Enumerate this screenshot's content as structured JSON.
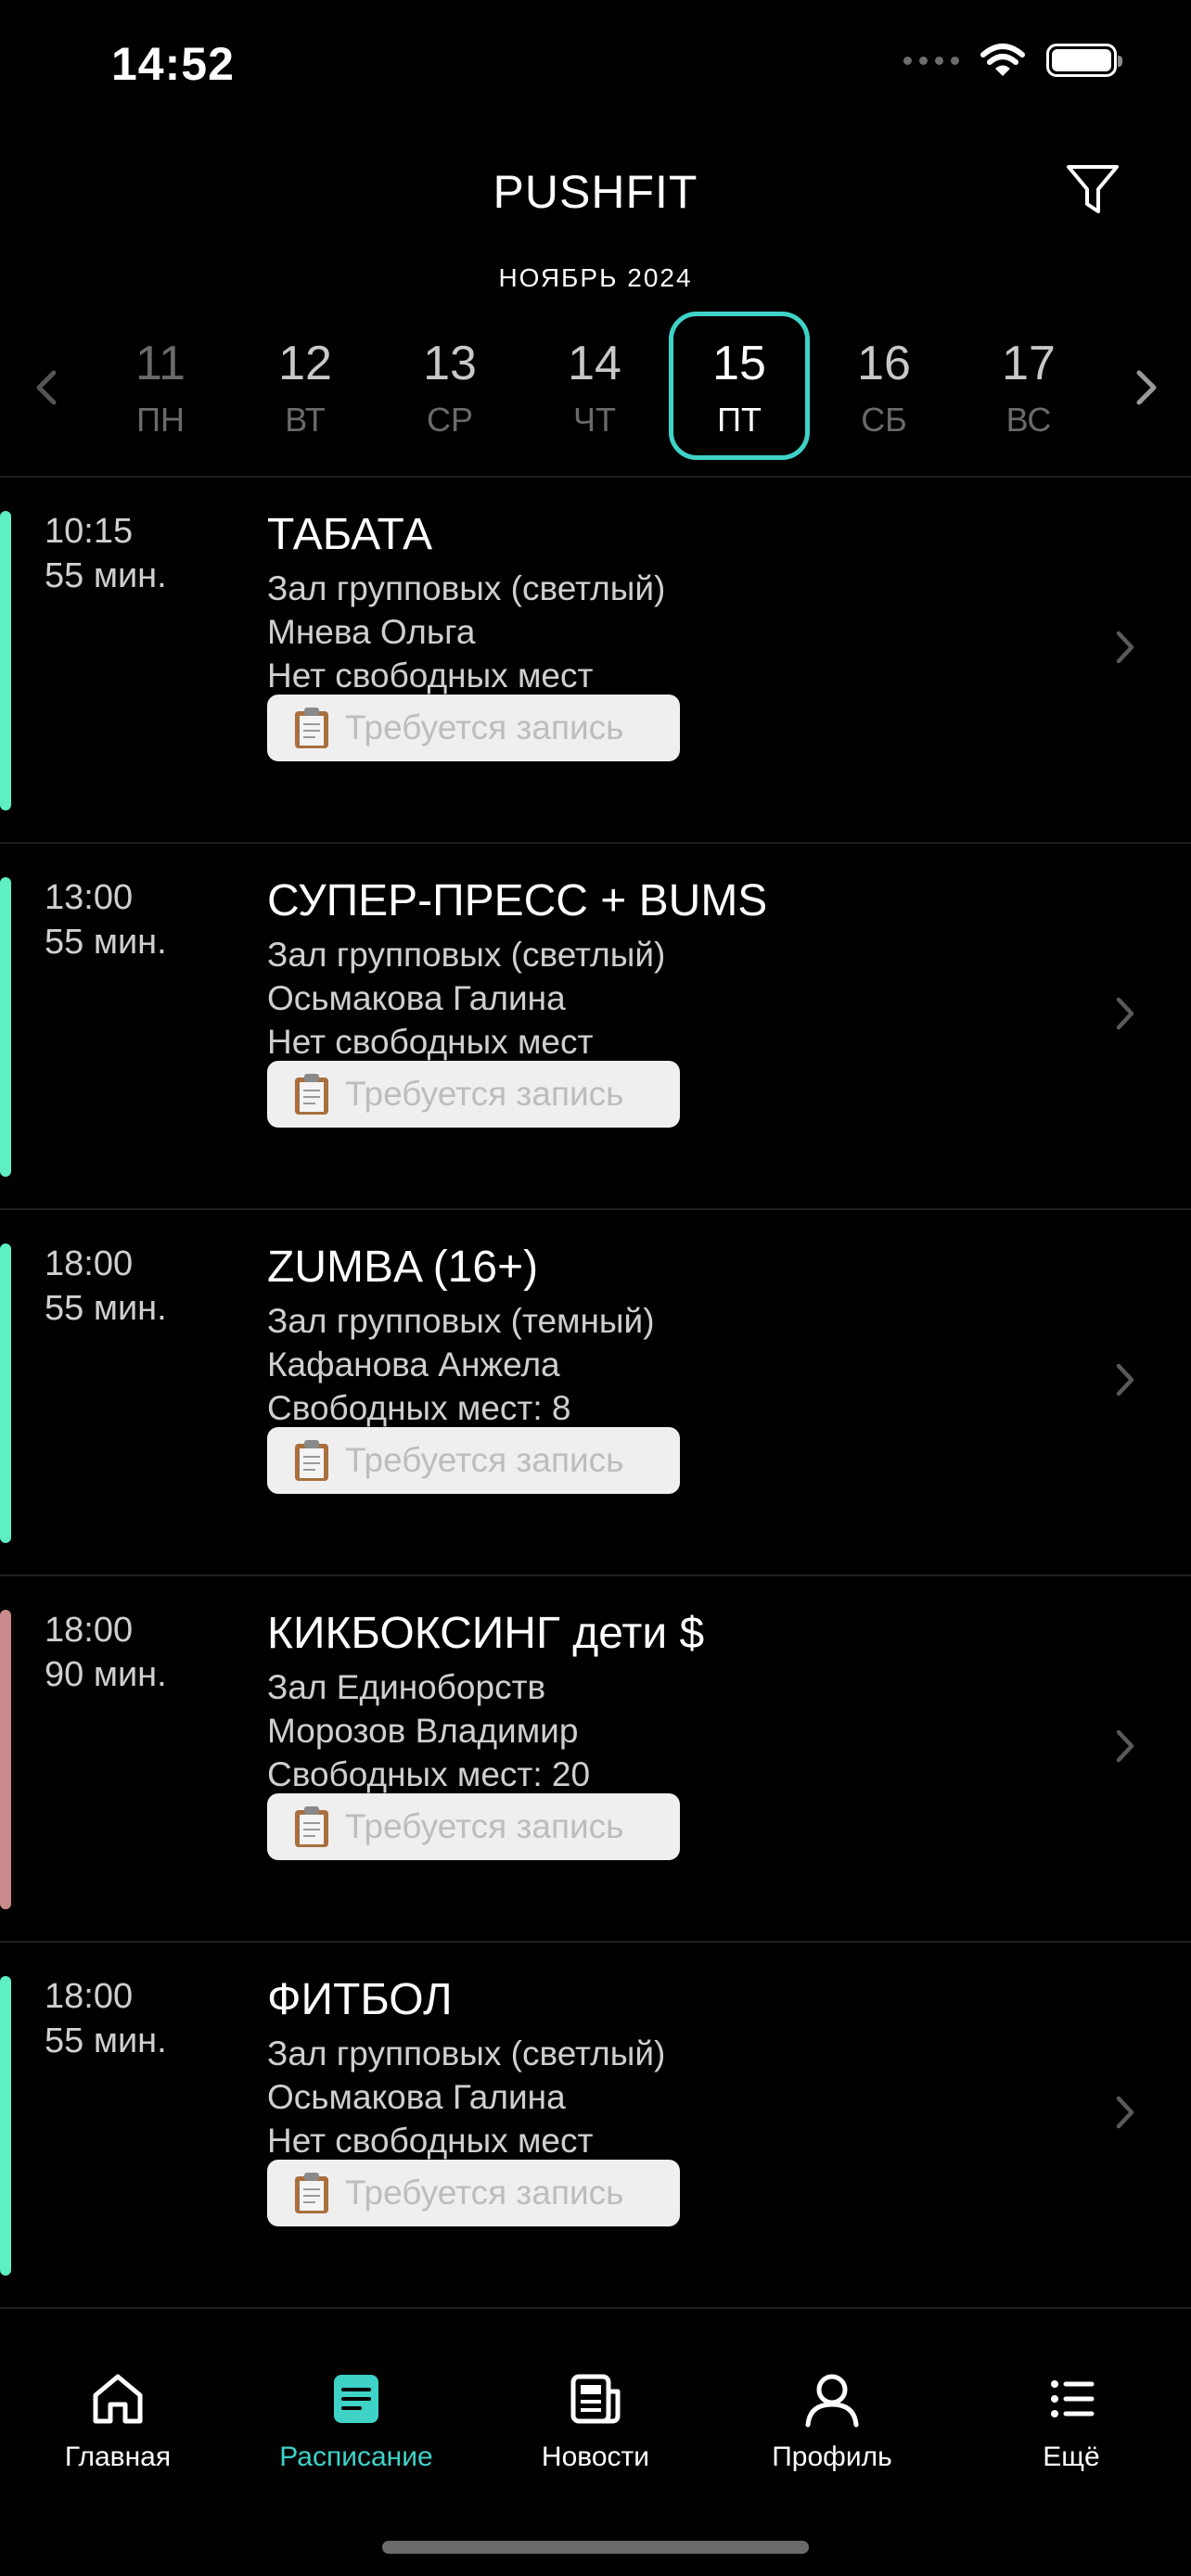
{
  "status_bar": {
    "time": "14:52"
  },
  "header": {
    "title": "PUSHFIT"
  },
  "calendar": {
    "month": "НОЯБРЬ 2024",
    "days": [
      {
        "num": "11",
        "weekday": "ПН"
      },
      {
        "num": "12",
        "weekday": "ВТ"
      },
      {
        "num": "13",
        "weekday": "СР"
      },
      {
        "num": "14",
        "weekday": "ЧТ"
      },
      {
        "num": "15",
        "weekday": "ПТ"
      },
      {
        "num": "16",
        "weekday": "СБ"
      },
      {
        "num": "17",
        "weekday": "ВС"
      }
    ],
    "selected_day": "15"
  },
  "classes": [
    {
      "time": "10:15",
      "duration": "55 мин.",
      "title": "ТАБАТА",
      "room": "Зал групповых (светлый)",
      "trainer": "Мнева Ольга",
      "availability": "Нет свободных мест",
      "badge": "Требуется запись",
      "accent_color": "#5ef0c4"
    },
    {
      "time": "13:00",
      "duration": "55 мин.",
      "title": "СУПЕР-ПРЕСС + BUMS",
      "room": "Зал групповых (светлый)",
      "trainer": "Осьмакова Галина",
      "availability": "Нет свободных мест",
      "badge": "Требуется запись",
      "accent_color": "#5ef0c4"
    },
    {
      "time": "18:00",
      "duration": "55 мин.",
      "title": "ZUMBA (16+)",
      "room": "Зал групповых (темный)",
      "trainer": "Кафанова Анжела",
      "availability": "Свободных мест: 8",
      "badge": "Требуется запись",
      "accent_color": "#5ef0c4"
    },
    {
      "time": "18:00",
      "duration": "90 мин.",
      "title": "КИКБОКСИНГ дети $",
      "room": "Зал Единоборств",
      "trainer": "Морозов Владимир",
      "availability": "Свободных мест: 20",
      "badge": "Требуется запись",
      "accent_color": "#c98b8b"
    },
    {
      "time": "18:00",
      "duration": "55 мин.",
      "title": "ФИТБОЛ",
      "room": "Зал групповых (светлый)",
      "trainer": "Осьмакова Галина",
      "availability": "Нет свободных мест",
      "badge": "Требуется запись",
      "accent_color": "#5ef0c4"
    }
  ],
  "tab_bar": {
    "items": [
      {
        "label": "Главная",
        "icon": "home-icon"
      },
      {
        "label": "Расписание",
        "icon": "schedule-icon",
        "active": true
      },
      {
        "label": "Новости",
        "icon": "news-icon"
      },
      {
        "label": "Профиль",
        "icon": "profile-icon"
      },
      {
        "label": "Ещё",
        "icon": "more-icon"
      }
    ]
  },
  "colors": {
    "accent": "#3fd2c7",
    "background": "#000000"
  }
}
